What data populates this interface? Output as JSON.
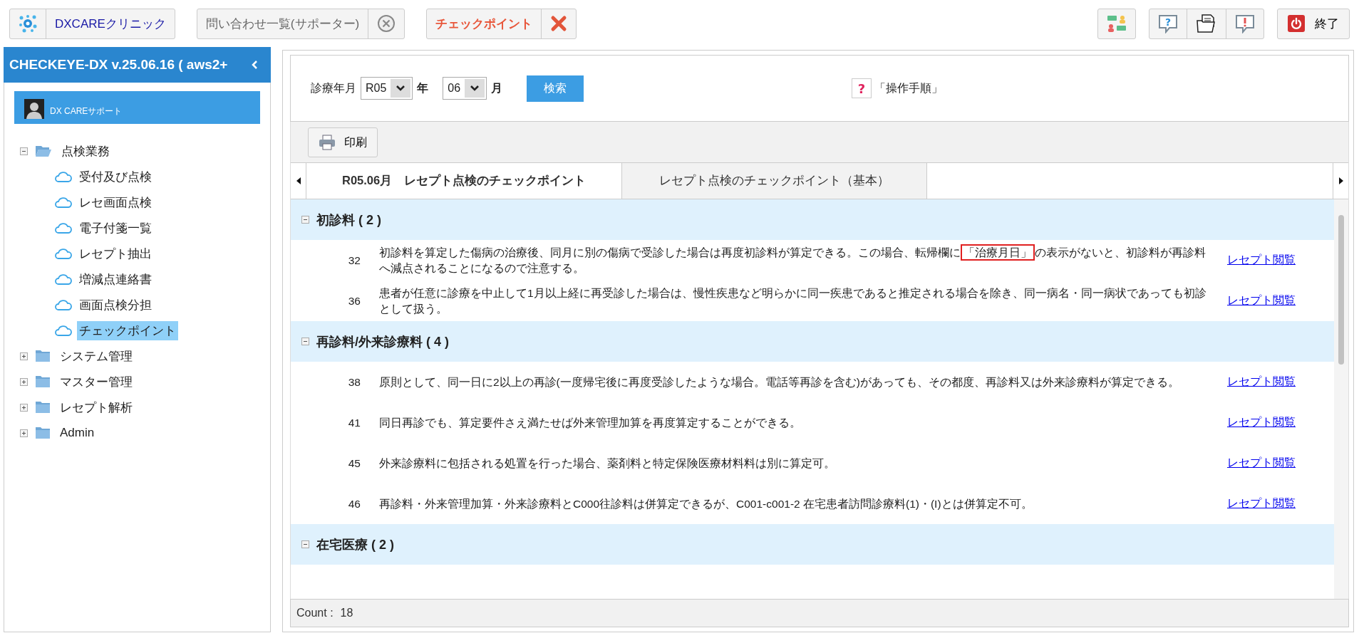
{
  "toolbar": {
    "clinic_button": "DXCAREクリニック",
    "tabs": [
      {
        "label": "問い合わせ一覧(サポーター)",
        "selected": false
      },
      {
        "label": "チェックポイント",
        "selected": true
      }
    ],
    "help_icon": "?",
    "exit_button": "終了"
  },
  "sidebar": {
    "title": "CHECKEYE-DX v.25.06.16 ( aws2+",
    "user": "DX CAREサポート",
    "tree": [
      {
        "label": "点検業務",
        "expanded": true,
        "children": [
          {
            "label": "受付及び点検",
            "selected": false
          },
          {
            "label": "レセ画面点検",
            "selected": false
          },
          {
            "label": "電子付箋一覧",
            "selected": false
          },
          {
            "label": "レセプト抽出",
            "selected": false
          },
          {
            "label": "増減点連絡書",
            "selected": false
          },
          {
            "label": "画面点検分担",
            "selected": false
          },
          {
            "label": "チェックポイント",
            "selected": true
          }
        ]
      },
      {
        "label": "システム管理",
        "expanded": false
      },
      {
        "label": "マスター管理",
        "expanded": false
      },
      {
        "label": "レセプト解析",
        "expanded": false
      },
      {
        "label": "Admin",
        "expanded": false
      }
    ]
  },
  "filter": {
    "label": "診療年月",
    "year": {
      "value": "R05",
      "unit": "年"
    },
    "month": {
      "value": "06",
      "unit": "月"
    },
    "search_button": "検索",
    "help_icon": "?",
    "help_link": "「操作手順」"
  },
  "print_button": "印刷",
  "tabs": [
    {
      "label": "R05.06月　レセプト点検のチェックポイント",
      "selected": true
    },
    {
      "label": "レセプト点検のチェックポイント（基本）",
      "selected": false
    }
  ],
  "groups": [
    {
      "title": "初診料 ( 2 )",
      "expanded": true,
      "rows": [
        {
          "number": "32",
          "text_parts": [
            {
              "text": "初診料を算定した傷病の治療後、同月に別の傷病で受診した場合は再度初診料が算定できる。この場合、転帰欄に",
              "highlighted": false
            },
            {
              "text": "「治療月日」",
              "highlighted": true
            },
            {
              "text": "の表示がないと、初診料が再診料へ減点されることになるので注意する。",
              "highlighted": false
            }
          ],
          "link": "レセプト閲覧"
        },
        {
          "number": "36",
          "text_parts": [
            {
              "text": "患者が任意に診療を中止して1月以上経に再受診した場合は、慢性疾患など明らかに同一疾患であると推定される場合を除き、同一病名・同一病状であっても初診として扱う。",
              "highlighted": false
            }
          ],
          "link": "レセプト閲覧"
        }
      ]
    },
    {
      "title": "再診料/外来診療料 ( 4 )",
      "expanded": true,
      "rows": [
        {
          "number": "38",
          "text_parts": [
            {
              "text": "原則として、同一日に2以上の再診(一度帰宅後に再度受診したような場合。電話等再診を含む)があっても、その都度、再診料又は外来診療料が算定できる。",
              "highlighted": false
            }
          ],
          "link": "レセプト閲覧"
        },
        {
          "number": "41",
          "text_parts": [
            {
              "text": "同日再診でも、算定要件さえ満たせば外来管理加算を再度算定することができる。",
              "highlighted": false
            }
          ],
          "link": "レセプト閲覧"
        },
        {
          "number": "45",
          "text_parts": [
            {
              "text": "外来診療料に包括される処置を行った場合、薬剤料と特定保険医療材料料は別に算定可。",
              "highlighted": false
            }
          ],
          "link": "レセプト閲覧"
        },
        {
          "number": "46",
          "text_parts": [
            {
              "text": "再診料・外来管理加算・外来診療料とC000往診料は併算定できるが、C001-c001-2 在宅患者訪問診療料(1)・(I)とは併算定不可。",
              "highlighted": false
            }
          ],
          "link": "レセプト閲覧"
        }
      ]
    },
    {
      "title": "在宅医療 ( 2 )",
      "expanded": true
    }
  ],
  "count": {
    "label": "Count :",
    "value": "18"
  }
}
